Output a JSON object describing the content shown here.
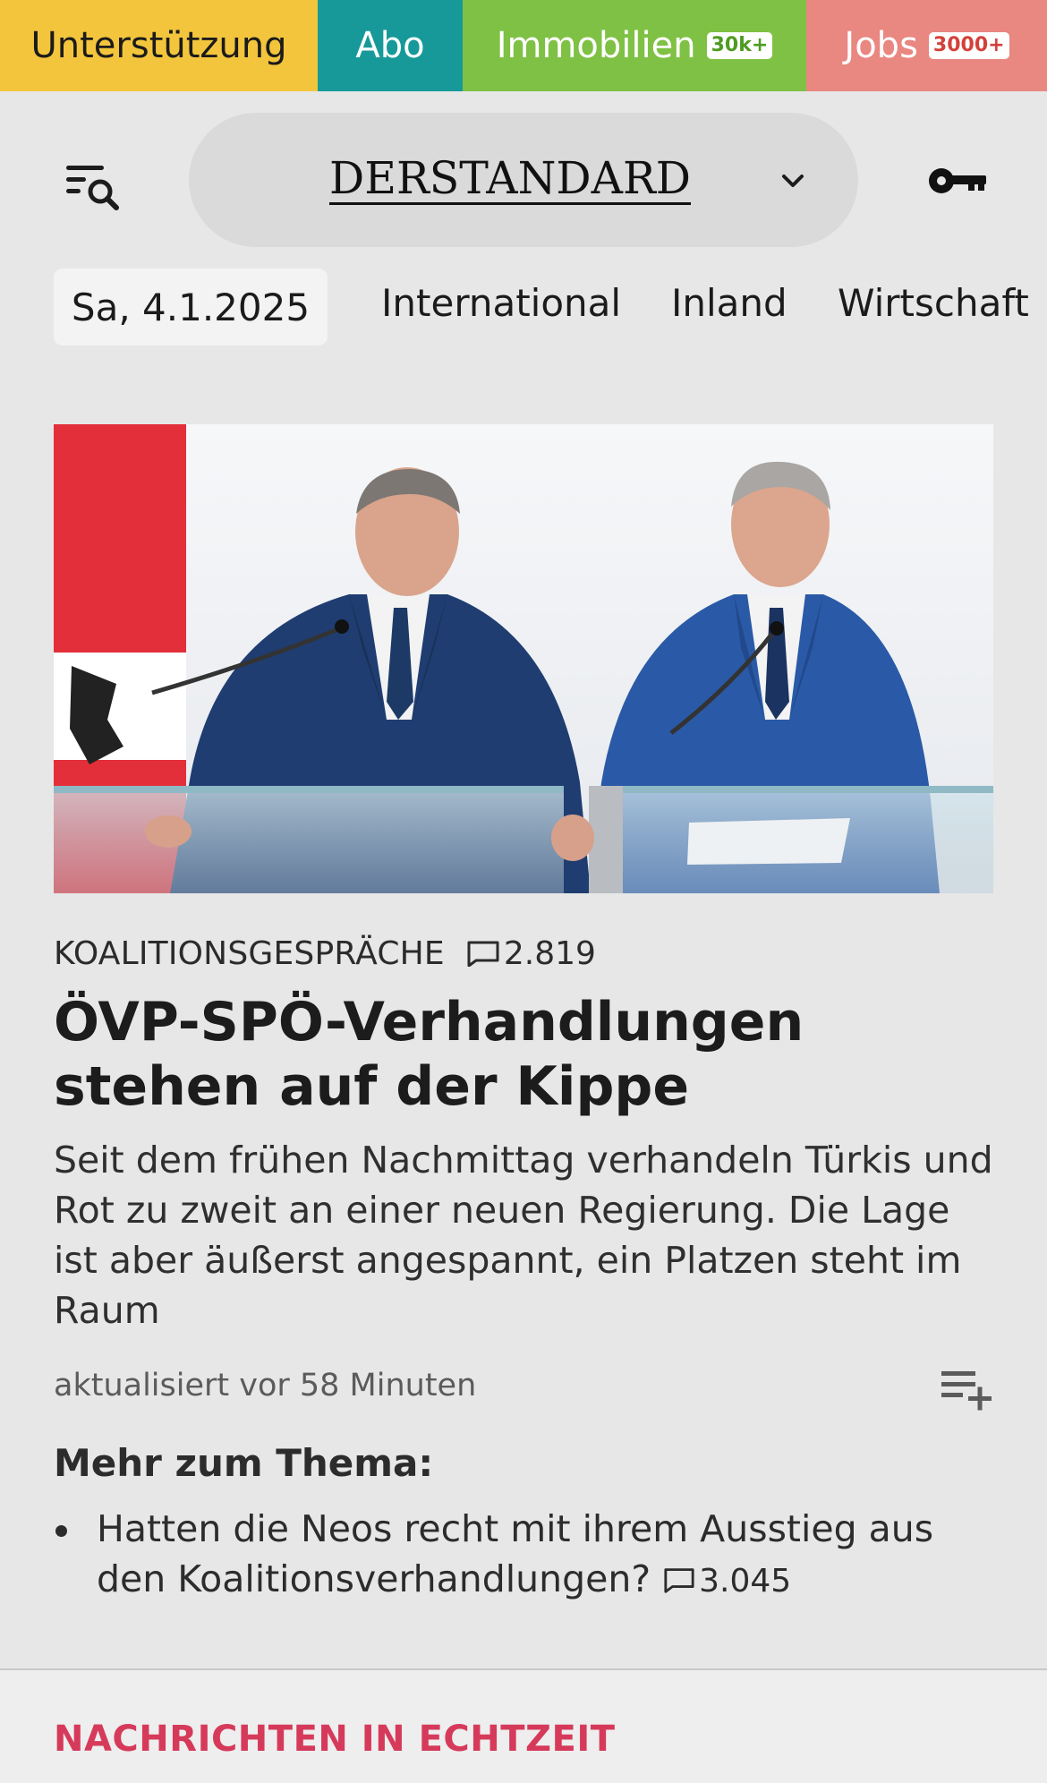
{
  "topbar": {
    "support_label": "Unterstützung",
    "abo_label": "Abo",
    "immo_label": "Immobilien",
    "immo_badge": "30k+",
    "jobs_label": "Jobs",
    "jobs_badge": "3000+"
  },
  "header": {
    "logo_text": "DERSTANDARD",
    "menu_icon": "search-menu-icon",
    "login_icon": "key-icon",
    "chevron_icon": "chevron-down-icon"
  },
  "nav": {
    "date": "Sa, 4.1.2025",
    "items": [
      "International",
      "Inland",
      "Wirtschaft"
    ]
  },
  "article": {
    "kicker": "KOALITIONSGESPRÄCHE",
    "comment_count": "2.819",
    "headline": "ÖVP-SPÖ-Verhandlungen stehen auf der Kippe",
    "teaser": "Seit dem frühen Nachmittag verhandeln Türkis und Rot zu zweit an einer neuen Regierung. Die Lage ist aber äußerst angespannt, ein Platzen steht im Raum",
    "updated": "aktualisiert vor 58 Minuten",
    "playlist_icon": "playlist-add-icon"
  },
  "more": {
    "title": "Mehr zum Thema:",
    "items": [
      {
        "text": "Hatten die Neos recht mit ihrem Ausstieg aus den Koalitionsverhandlungen?",
        "comments": "3.045"
      }
    ]
  },
  "live": {
    "title": "NACHRICHTEN IN ECHTZEIT"
  },
  "colors": {
    "support": "#f3c53c",
    "abo": "#17999a",
    "immo": "#7fc144",
    "jobs": "#e98781",
    "live_accent": "#d63a5b",
    "page_bg": "#e7e7e7"
  }
}
